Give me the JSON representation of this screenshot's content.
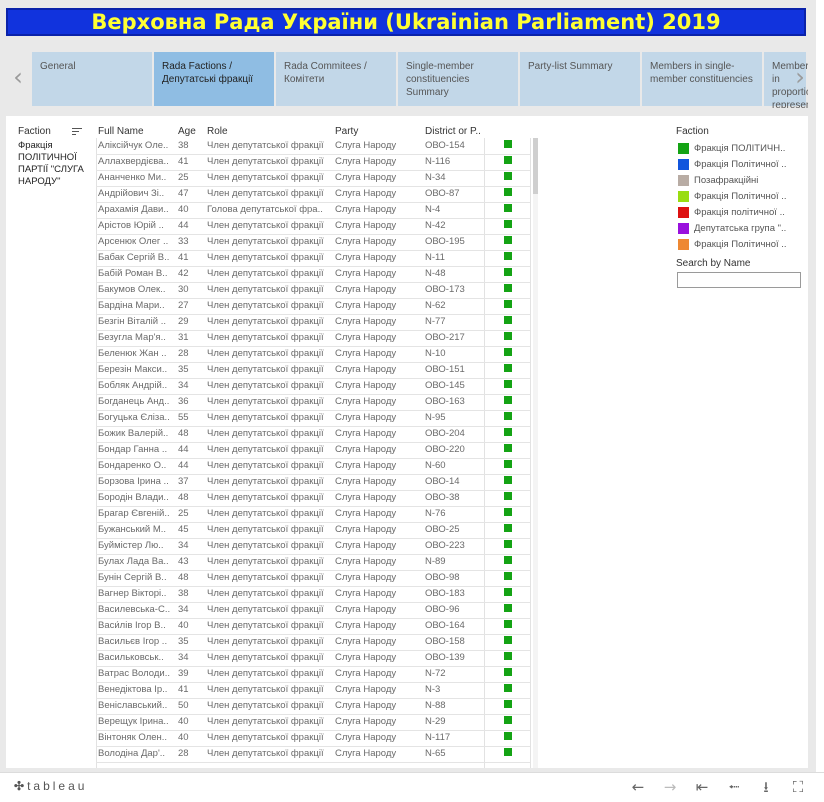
{
  "title": "Верховна Рада України (Ukrainian Parliament) 2019",
  "nav": {
    "prev_icon": "chevron-left",
    "next_icon": "chevron-right"
  },
  "tabs": [
    {
      "label": "General"
    },
    {
      "label": "Rada Factions / Депутатські фракції"
    },
    {
      "label": "Rada Commitees / Комітети"
    },
    {
      "label": "Single-member constituencies Summary"
    },
    {
      "label": "Party-list Summary"
    },
    {
      "label": "Members in single-member constituencies"
    },
    {
      "label": "Members in proportional representation"
    }
  ],
  "active_tab": 1,
  "table": {
    "columns": {
      "faction": "Faction",
      "full_name": "Full Name",
      "age": "Age",
      "role": "Role",
      "party": "Party",
      "district": "District or P.."
    },
    "faction_group": "Фракція ПОЛІТИЧНОЇ ПАРТІЇ \"СЛУГА НАРОДУ\"",
    "marker_color": "#14a314",
    "rows": [
      {
        "name": "Аліксійчук Оле..",
        "age": "38",
        "role": "Член депутатської фракції",
        "party": "Слуга Народу",
        "district": "ОВО-154"
      },
      {
        "name": "Аллахвердієва..",
        "age": "41",
        "role": "Член депутатської фракції",
        "party": "Слуга Народу",
        "district": "N-116"
      },
      {
        "name": "Ананченко Ми..",
        "age": "25",
        "role": "Член депутатської фракції",
        "party": "Слуга Народу",
        "district": "N-34"
      },
      {
        "name": "Андрійович Зі..",
        "age": "47",
        "role": "Член депутатської фракції",
        "party": "Слуга Народу",
        "district": "ОВО-87"
      },
      {
        "name": "Арахамія Дави..",
        "age": "40",
        "role": "Голова депутатської фра..",
        "party": "Слуга Народу",
        "district": "N-4"
      },
      {
        "name": "Арістов Юрій ..",
        "age": "44",
        "role": "Член депутатської фракції",
        "party": "Слуга Народу",
        "district": "N-42"
      },
      {
        "name": "Арсенюк Олег ..",
        "age": "33",
        "role": "Член депутатської фракції",
        "party": "Слуга Народу",
        "district": "ОВО-195"
      },
      {
        "name": "Бабак Сергій В..",
        "age": "41",
        "role": "Член депутатської фракції",
        "party": "Слуга Народу",
        "district": "N-11"
      },
      {
        "name": "Бабій Роман В..",
        "age": "42",
        "role": "Член депутатської фракції",
        "party": "Слуга Народу",
        "district": "N-48"
      },
      {
        "name": "Бакумов Олек..",
        "age": "30",
        "role": "Член депутатської фракції",
        "party": "Слуга Народу",
        "district": "ОВО-173"
      },
      {
        "name": "Бардіна Мари..",
        "age": "27",
        "role": "Член депутатської фракції",
        "party": "Слуга Народу",
        "district": "N-62"
      },
      {
        "name": "Безгін Віталій ..",
        "age": "29",
        "role": "Член депутатської фракції",
        "party": "Слуга Народу",
        "district": "N-77"
      },
      {
        "name": "Безугла Мар'я..",
        "age": "31",
        "role": "Член депутатської фракції",
        "party": "Слуга Народу",
        "district": "ОВО-217"
      },
      {
        "name": "Беленюк Жан ..",
        "age": "28",
        "role": "Член депутатської фракції",
        "party": "Слуга Народу",
        "district": "N-10"
      },
      {
        "name": "Березін Макси..",
        "age": "35",
        "role": "Член депутатської фракції",
        "party": "Слуга Народу",
        "district": "ОВО-151"
      },
      {
        "name": "Бобляк Андрій..",
        "age": "34",
        "role": "Член депутатської фракції",
        "party": "Слуга Народу",
        "district": "ОВО-145"
      },
      {
        "name": "Богданець Анд..",
        "age": "36",
        "role": "Член депутатської фракції",
        "party": "Слуга Народу",
        "district": "ОВО-163"
      },
      {
        "name": "Богуцька Єліза..",
        "age": "55",
        "role": "Член депутатської фракції",
        "party": "Слуга Народу",
        "district": "N-95"
      },
      {
        "name": "Божик Валерій..",
        "age": "48",
        "role": "Член депутатської фракції",
        "party": "Слуга Народу",
        "district": "ОВО-204"
      },
      {
        "name": "Бондар Ганна ..",
        "age": "44",
        "role": "Член депутатської фракції",
        "party": "Слуга Народу",
        "district": "ОВО-220"
      },
      {
        "name": "Бондаренко О..",
        "age": "44",
        "role": "Член депутатської фракції",
        "party": "Слуга Народу",
        "district": "N-60"
      },
      {
        "name": "Борзова Ірина ..",
        "age": "37",
        "role": "Член депутатської фракції",
        "party": "Слуга Народу",
        "district": "ОВО-14"
      },
      {
        "name": "Бородін Влади..",
        "age": "48",
        "role": "Член депутатської фракції",
        "party": "Слуга Народу",
        "district": "ОВО-38"
      },
      {
        "name": "Брагар Євгеній..",
        "age": "25",
        "role": "Член депутатської фракції",
        "party": "Слуга Народу",
        "district": "N-76"
      },
      {
        "name": "Бужанський М..",
        "age": "45",
        "role": "Член депутатської фракції",
        "party": "Слуга Народу",
        "district": "ОВО-25"
      },
      {
        "name": "Буймістер Лю..",
        "age": "34",
        "role": "Член депутатської фракції",
        "party": "Слуга Народу",
        "district": "ОВО-223"
      },
      {
        "name": "Булах Лада Ва..",
        "age": "43",
        "role": "Член депутатської фракції",
        "party": "Слуга Народу",
        "district": "N-89"
      },
      {
        "name": "Бунін Сергій В..",
        "age": "48",
        "role": "Член депутатської фракції",
        "party": "Слуга Народу",
        "district": "ОВО-98"
      },
      {
        "name": "Вагнер Вікторі..",
        "age": "38",
        "role": "Член депутатської фракції",
        "party": "Слуга Народу",
        "district": "ОВО-183"
      },
      {
        "name": "Василевська-С..",
        "age": "34",
        "role": "Член депутатської фракції",
        "party": "Слуга Народу",
        "district": "ОВО-96"
      },
      {
        "name": "Васи́лів Ігор В..",
        "age": "40",
        "role": "Член депутатської фракції",
        "party": "Слуга Народу",
        "district": "ОВО-164"
      },
      {
        "name": "Васильєв Ігор ..",
        "age": "35",
        "role": "Член депутатської фракції",
        "party": "Слуга Народу",
        "district": "ОВО-158"
      },
      {
        "name": "Васильковськ..",
        "age": "34",
        "role": "Член депутатської фракції",
        "party": "Слуга Народу",
        "district": "ОВО-139"
      },
      {
        "name": "Ватрас Володи..",
        "age": "39",
        "role": "Член депутатської фракції",
        "party": "Слуга Народу",
        "district": "N-72"
      },
      {
        "name": "Венедіктова Ір..",
        "age": "41",
        "role": "Член депутатської фракції",
        "party": "Слуга Народу",
        "district": "N-3"
      },
      {
        "name": "Веніславський..",
        "age": "50",
        "role": "Член депутатської фракції",
        "party": "Слуга Народу",
        "district": "N-88"
      },
      {
        "name": "Верещук Ірина..",
        "age": "40",
        "role": "Член депутатської фракції",
        "party": "Слуга Народу",
        "district": "N-29"
      },
      {
        "name": "Вінтоняк Олен..",
        "age": "40",
        "role": "Член депутатської фракції",
        "party": "Слуга Народу",
        "district": "N-117"
      },
      {
        "name": "Володіна Дар'..",
        "age": "28",
        "role": "Член депутатської фракції",
        "party": "Слуга Народу",
        "district": "N-65"
      }
    ]
  },
  "legend": {
    "title": "Faction",
    "items": [
      {
        "label": "Фракція ПОЛІТИЧН..",
        "color": "#14a314"
      },
      {
        "label": "Фракція Політичної ..",
        "color": "#1155dd"
      },
      {
        "label": "Позафракційні",
        "color": "#b8aca4"
      },
      {
        "label": "Фракція Політичної ..",
        "color": "#99dd11"
      },
      {
        "label": "Фракція політичної ..",
        "color": "#dd1111"
      },
      {
        "label": "Депутатська група \"..",
        "color": "#9911dd"
      },
      {
        "label": "Фракція Політичної ..",
        "color": "#ee8833"
      }
    ]
  },
  "search": {
    "label": "Search by Name",
    "value": ""
  },
  "footer": {
    "brand": "tableau"
  }
}
